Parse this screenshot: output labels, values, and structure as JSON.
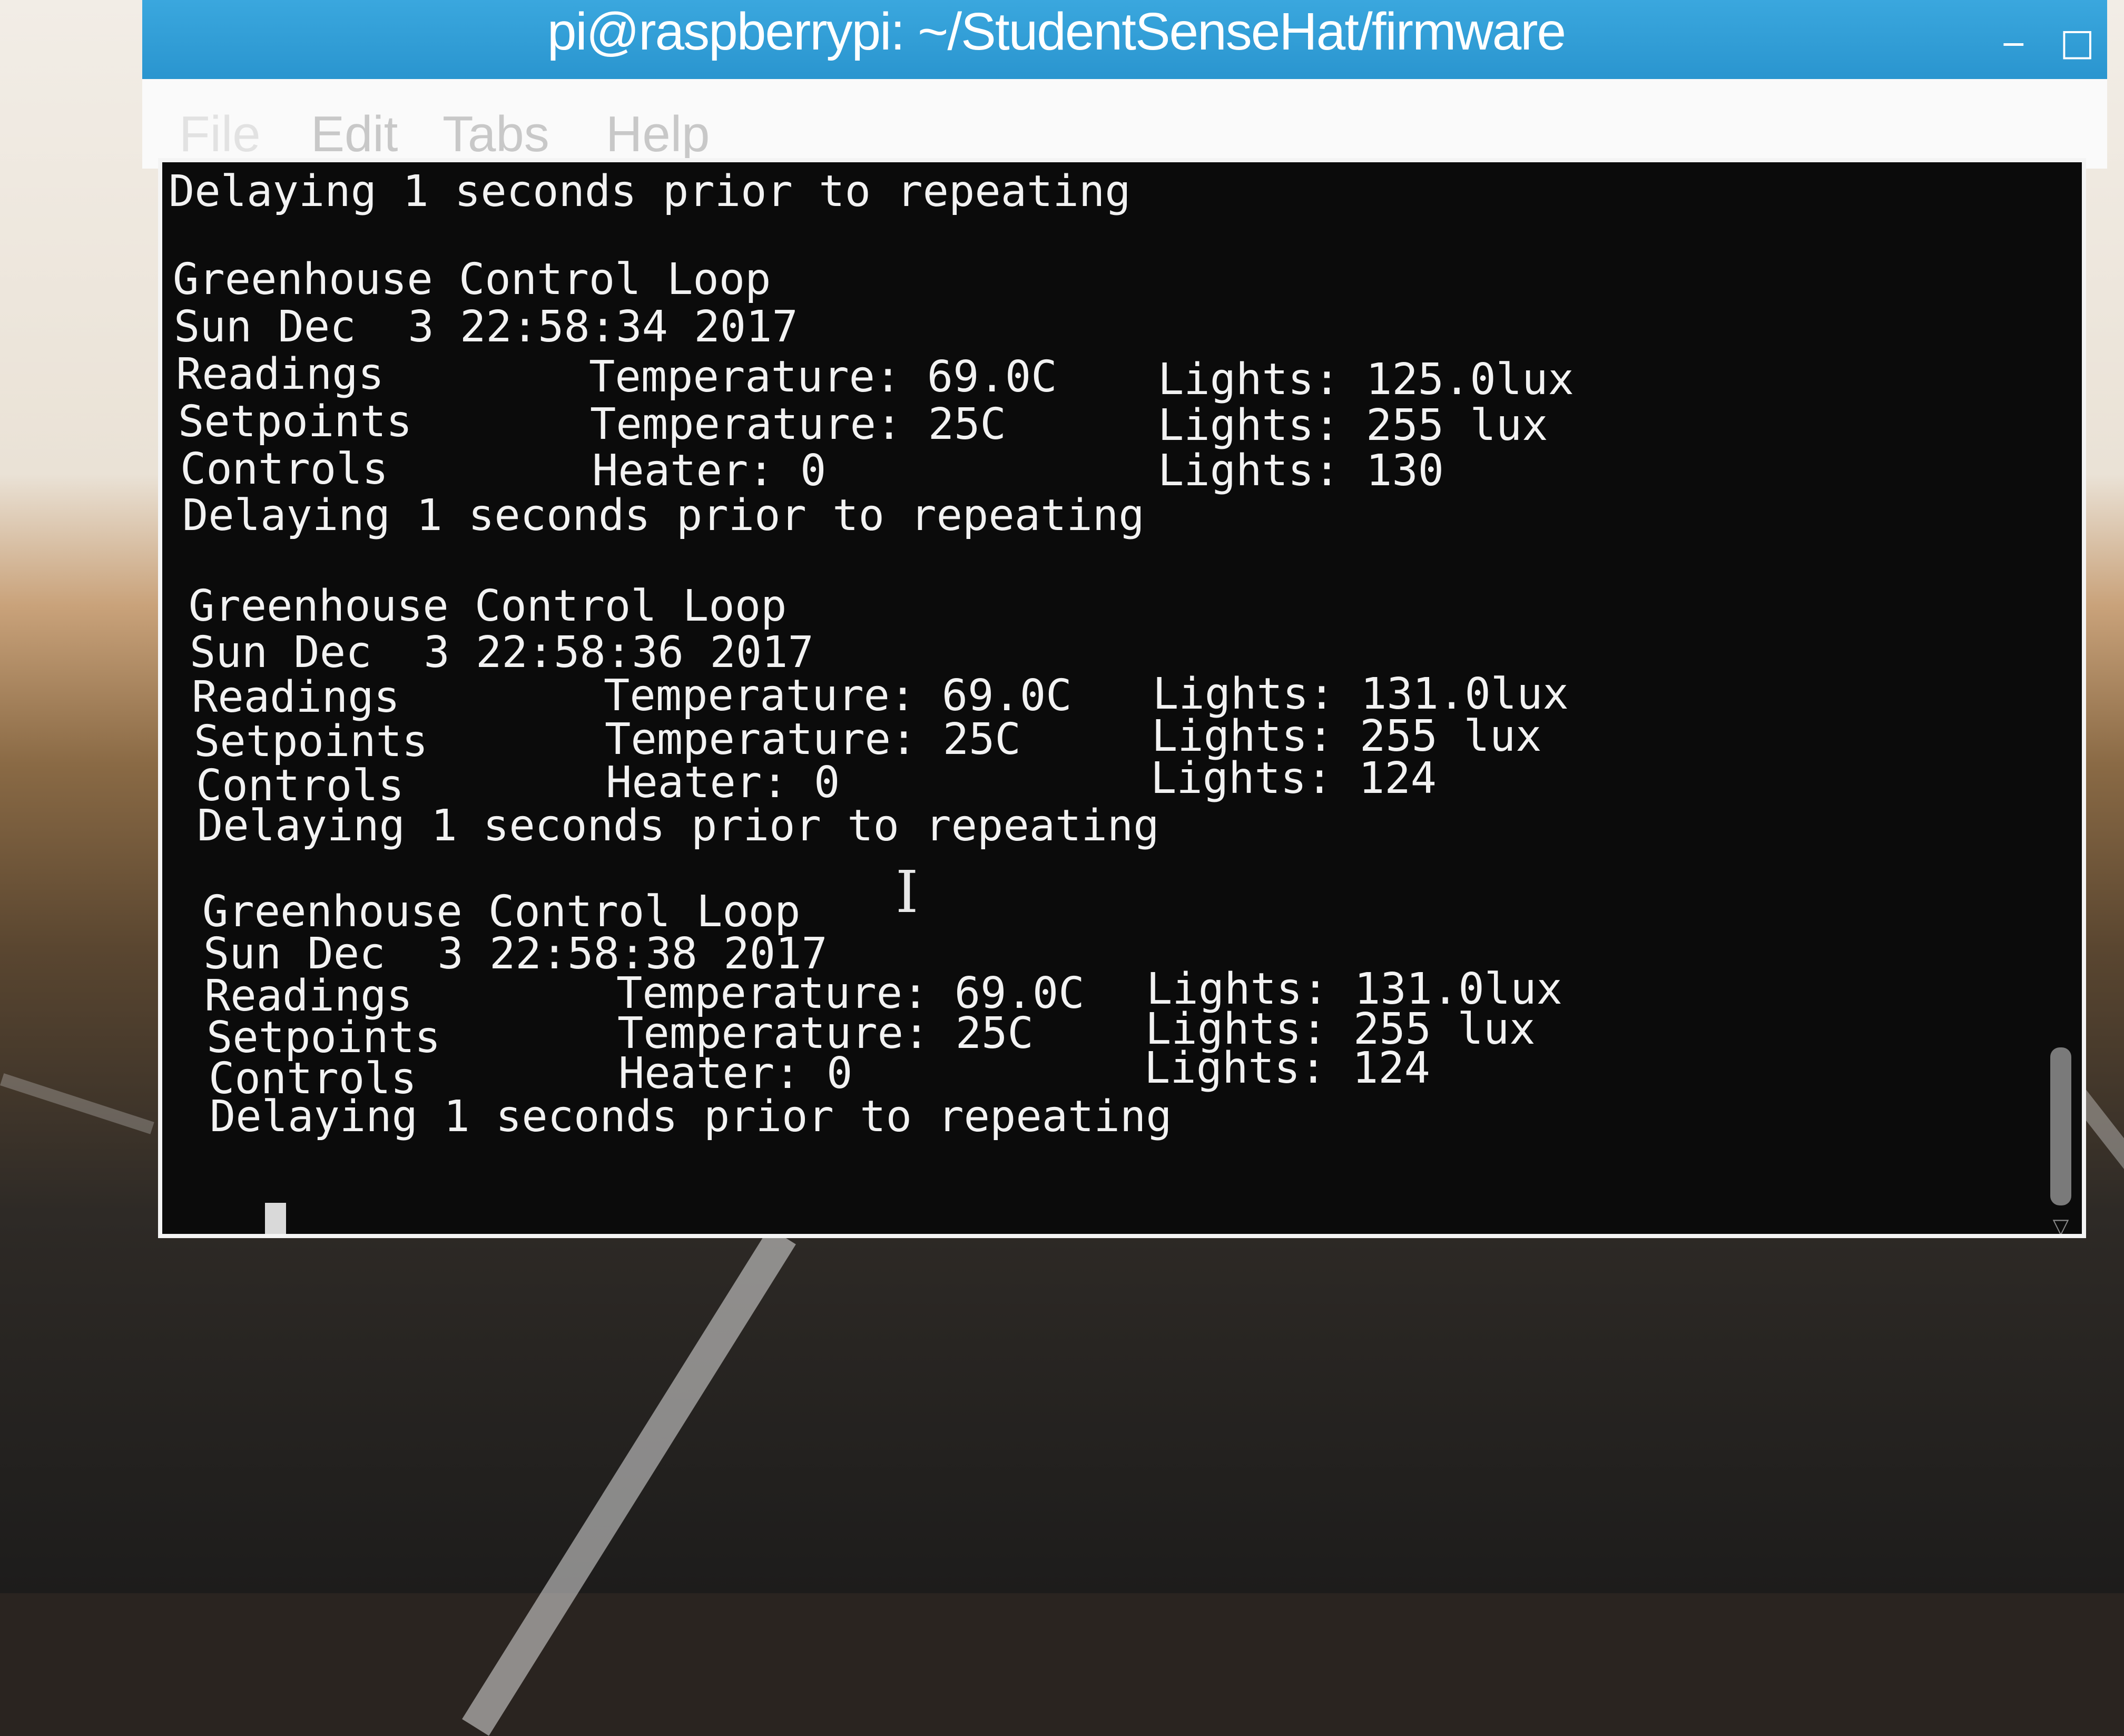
{
  "window": {
    "title": "pi@raspberrypi: ~/StudentSenseHat/firmware",
    "minimize_glyph": "‒",
    "maximize_glyph": "□"
  },
  "menubar": {
    "items": [
      {
        "label": "File"
      },
      {
        "label": "Edit"
      },
      {
        "label": "Tabs"
      },
      {
        "label": "Help"
      }
    ]
  },
  "terminal": {
    "lines": {
      "delay0": "Delaying 1 seconds prior to repeating",
      "b1_title": "Greenhouse Control Loop",
      "b1_date": "Sun Dec  3 22:58:34 2017",
      "b1_readings_label": "Readings",
      "b1_readings_temp": "Temperature: 69.0C",
      "b1_readings_lights": "Lights: 125.0lux",
      "b1_setpoints_label": "Setpoints",
      "b1_setpoints_temp": "Temperature: 25C",
      "b1_setpoints_lights": "Lights: 255 lux",
      "b1_controls_label": "Controls",
      "b1_controls_heater": "Heater: 0",
      "b1_controls_lights": "Lights: 130",
      "b1_delay": "Delaying 1 seconds prior to repeating",
      "b2_title": "Greenhouse Control Loop",
      "b2_date": "Sun Dec  3 22:58:36 2017",
      "b2_readings_label": "Readings",
      "b2_readings_temp": "Temperature: 69.0C",
      "b2_readings_lights": "Lights: 131.0lux",
      "b2_setpoints_label": "Setpoints",
      "b2_setpoints_temp": "Temperature: 25C",
      "b2_setpoints_lights": "Lights: 255 lux",
      "b2_controls_label": "Controls",
      "b2_controls_heater": "Heater: 0",
      "b2_controls_lights": "Lights: 124",
      "b2_delay": "Delaying 1 seconds prior to repeating",
      "b3_title": "Greenhouse Control Loop",
      "b3_date": "Sun Dec  3 22:58:38 2017",
      "b3_readings_label": "Readings",
      "b3_readings_temp": "Temperature: 69.0C",
      "b3_readings_lights": "Lights: 131.0lux",
      "b3_setpoints_label": "Setpoints",
      "b3_setpoints_temp": "Temperature: 25C",
      "b3_setpoints_lights": "Lights: 255 lux",
      "b3_controls_label": "Controls",
      "b3_controls_heater": "Heater: 0",
      "b3_controls_lights": "Lights: 124",
      "b3_delay": "Delaying 1 seconds prior to repeating"
    },
    "ibeam_glyph": "I"
  },
  "colors": {
    "titlebar": "#2a95cf",
    "terminal_bg": "#0b0b0b",
    "terminal_fg": "#f2f2f2"
  }
}
